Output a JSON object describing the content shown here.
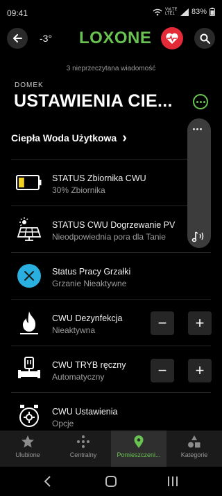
{
  "statusbar": {
    "time": "09:41",
    "network": "VoLTE LTE1",
    "battery": "83%"
  },
  "header": {
    "temperature": "-3°",
    "logo": "LOXONE"
  },
  "notice": "3 nieprzeczytana wiadomość",
  "room": {
    "eyebrow": "DOMEK",
    "title": "USTAWIENIA CIE..."
  },
  "category": {
    "label": "Ciepła Woda Użytkowa",
    "chevron": "›"
  },
  "rows": [
    {
      "title": "STATUS Zbiornika CWU",
      "subtitle": "30% Zbiornika",
      "icon": "battery-low-icon",
      "fill_fraction": 0.3,
      "accent": "#f0d020"
    },
    {
      "title": "STATUS CWU Dogrzewanie PV",
      "subtitle": "Nieodpowiednia pora dla Tanie",
      "icon": "solar-panel-icon"
    },
    {
      "title": "Status Pracy Grzałki",
      "subtitle": "Grzanie Nieaktywne",
      "icon": "x-circle-icon",
      "accent": "#2ab0e0"
    },
    {
      "title": "CWU Dezynfekcja",
      "subtitle": "Nieaktywna",
      "icon": "flame-icon",
      "minus": "−",
      "plus": "+"
    },
    {
      "title": "CWU TRYB ręczny",
      "subtitle": "Automatyczny",
      "icon": "valve-icon",
      "minus": "−",
      "plus": "+"
    },
    {
      "title": "CWU Ustawienia",
      "subtitle": "Opcje",
      "icon": "settings-dial-icon"
    }
  ],
  "tabs": [
    {
      "label": "Ulubione",
      "icon": "star-icon"
    },
    {
      "label": "Centralny",
      "icon": "central-dots-icon"
    },
    {
      "label": "Pomieszczeni...",
      "icon": "location-pin-icon",
      "active": true
    },
    {
      "label": "Kategorie",
      "icon": "shapes-icon"
    }
  ],
  "colors": {
    "brand": "#69c350",
    "heart": "#e32a37",
    "background": "#000000"
  }
}
